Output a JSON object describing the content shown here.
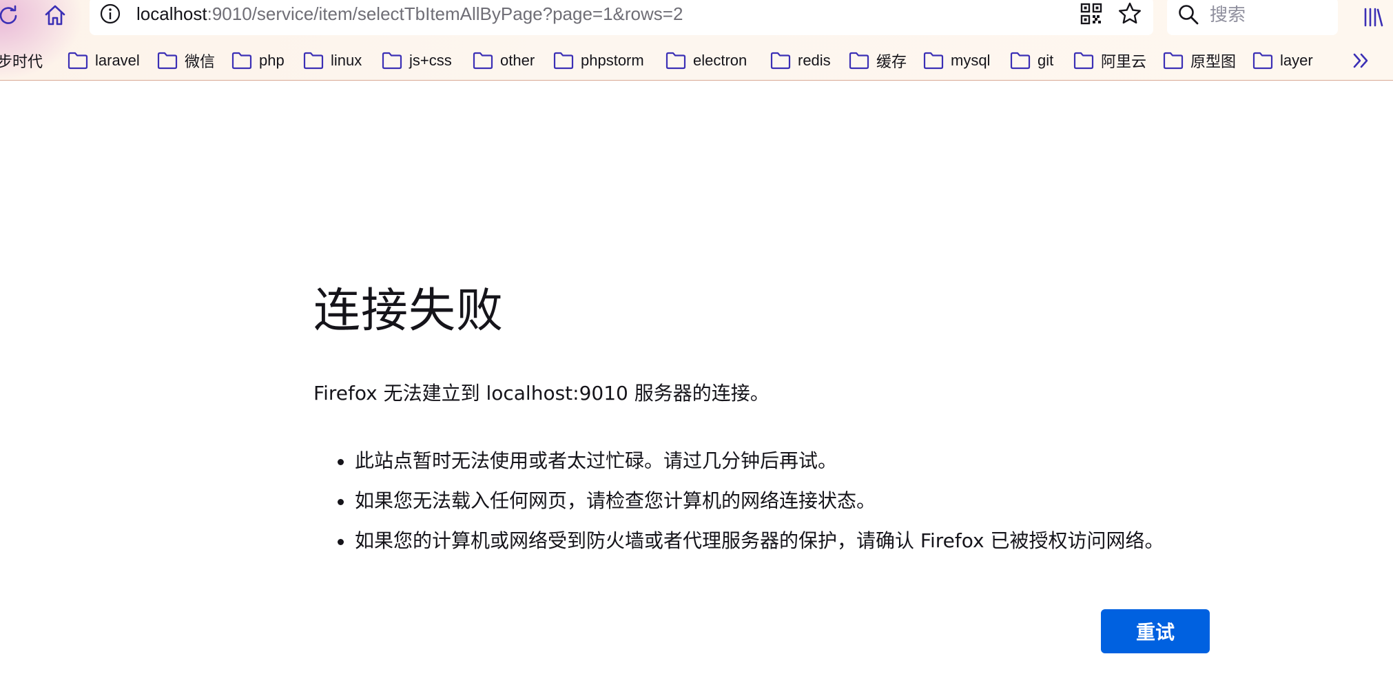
{
  "toolbar": {
    "reload_icon": "reload-icon",
    "home_icon": "home-icon"
  },
  "urlbar": {
    "host": "localhost",
    "rest": ":9010/service/item/selectTbItemAllByPage?page=1&rows=2",
    "info_icon": "info-icon",
    "qr_icon": "qr-code-icon",
    "star_icon": "star-icon"
  },
  "searchbar": {
    "placeholder": "搜索"
  },
  "bookmarks": {
    "items": [
      {
        "label": "步时代"
      },
      {
        "label": "laravel"
      },
      {
        "label": "微信"
      },
      {
        "label": "php"
      },
      {
        "label": "linux"
      },
      {
        "label": "js+css"
      },
      {
        "label": "other"
      },
      {
        "label": "phpstorm"
      },
      {
        "label": "electron"
      },
      {
        "label": "redis"
      },
      {
        "label": "缓存"
      },
      {
        "label": "mysql"
      },
      {
        "label": "git"
      },
      {
        "label": "阿里云"
      },
      {
        "label": "原型图"
      },
      {
        "label": "layer"
      }
    ]
  },
  "error": {
    "title": "连接失败",
    "description": "Firefox 无法建立到 localhost:9010 服务器的连接。",
    "reasons": [
      "此站点暂时无法使用或者太过忙碌。请过几分钟后再试。",
      "如果您无法载入任何网页，请检查您计算机的网络连接状态。",
      "如果您的计算机或网络受到防火墙或者代理服务器的保护，请确认 Firefox 已被授权访问网络。"
    ],
    "retry_label": "重试"
  },
  "colors": {
    "accent": "#0061e0",
    "chrome_icon": "#3b2fb5",
    "chrome_bg": "#fdf3ea"
  }
}
